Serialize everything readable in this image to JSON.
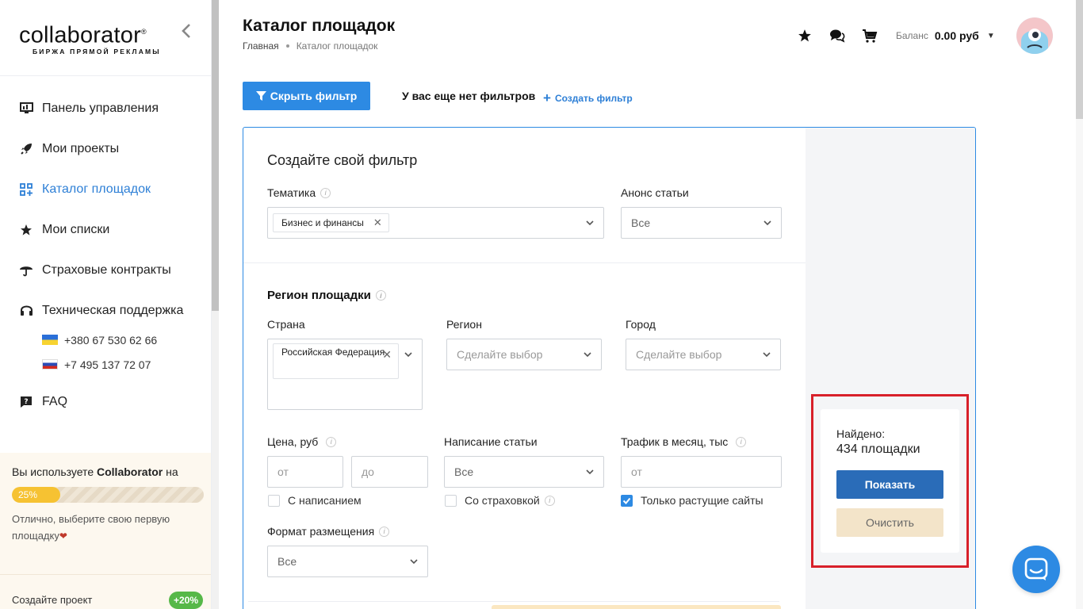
{
  "brand": {
    "logo_text": "collaborator",
    "logo_sub": "БИРЖА ПРЯМОЙ РЕКЛАМЫ"
  },
  "sidebar": {
    "items": [
      {
        "label": "Панель управления",
        "icon": "dashboard-icon"
      },
      {
        "label": "Мои проекты",
        "icon": "rocket-icon"
      },
      {
        "label": "Каталог площадок",
        "icon": "catalog-icon",
        "active": true
      },
      {
        "label": "Мои списки",
        "icon": "star-icon"
      },
      {
        "label": "Страховые контракты",
        "icon": "umbrella-icon"
      },
      {
        "label": "Техническая поддержка",
        "icon": "headset-icon"
      },
      {
        "label": "FAQ",
        "icon": "faq-icon"
      }
    ],
    "phones": [
      "+380 67 530 62 66",
      "+7 495 137 72 07"
    ],
    "usage": {
      "prefix": "Вы используете ",
      "brand": "Collaborator",
      "suffix": " на",
      "progress_label": "25%",
      "progress_value": 25,
      "note": "Отлично, выберите свою первую площадку"
    },
    "bottom": {
      "label": "Создайте проект",
      "badge": "+20%"
    }
  },
  "header": {
    "title": "Каталог площадок",
    "breadcrumb": [
      "Главная",
      "Каталог площадок"
    ],
    "balance_label": "Баланс",
    "balance_value": "0.00 руб"
  },
  "toolbar": {
    "hide_filter": "Скрыть фильтр",
    "no_filters": "У вас еще нет фильтров",
    "create_filter": "Создать фильтр"
  },
  "filter": {
    "title": "Создайте свой фильтр",
    "theme_label": "Тематика",
    "theme_tag": "Бизнес и финансы",
    "announce_label": "Анонс статьи",
    "announce_value": "Все",
    "region_section": "Регион площадки",
    "country_label": "Страна",
    "country_tag": "Российская Федерация",
    "region_label": "Регион",
    "region_placeholder": "Сделайте выбор",
    "city_label": "Город",
    "city_placeholder": "Сделайте выбор",
    "price_label": "Цена, руб",
    "price_from": "от",
    "price_to": "до",
    "writing_label": "Написание статьи",
    "writing_value": "Все",
    "traffic_label": "Трафик в месяц, тыс",
    "traffic_from": "от",
    "chk_writing": "С написанием",
    "chk_insurance": "Со страховкой",
    "chk_growing": "Только растущие сайты",
    "format_label": "Формат размещения",
    "format_value": "Все"
  },
  "results": {
    "found_label": "Найдено:",
    "found_count": "434 площадки",
    "show": "Показать",
    "clear": "Очистить"
  },
  "colors": {
    "accent": "#2d8ae3",
    "highlight": "#d8202a",
    "progress": "#f6c232"
  }
}
